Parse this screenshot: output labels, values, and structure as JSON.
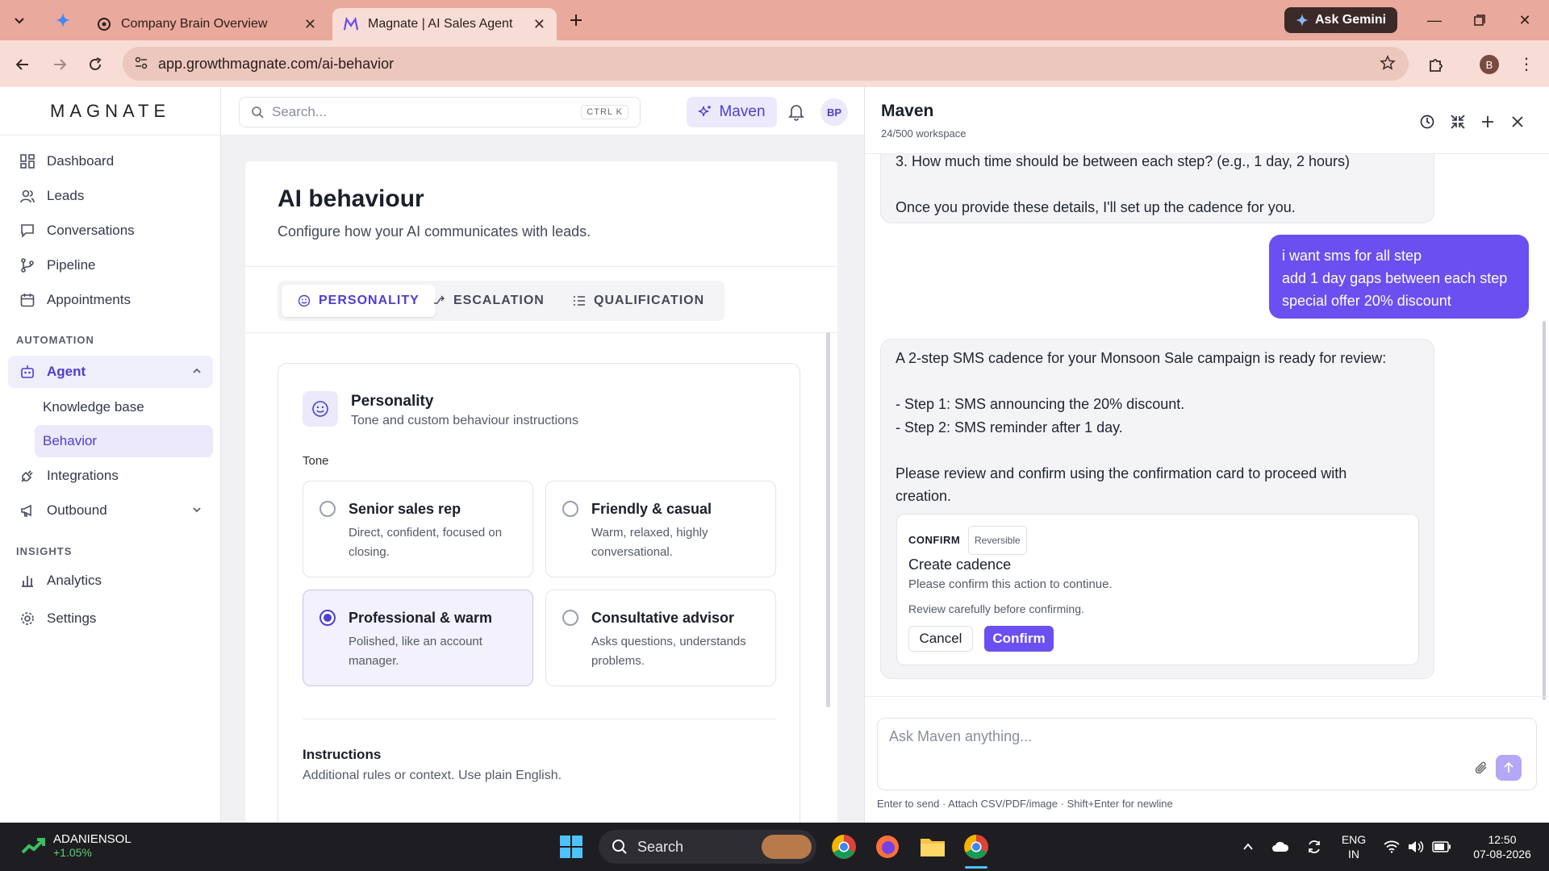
{
  "browser": {
    "tabs": [
      {
        "title": "Company Brain Overview",
        "active": false
      },
      {
        "title": "Magnate | AI Sales Agent",
        "active": true
      }
    ],
    "gemini_label": "Ask Gemini",
    "url": "app.growthmagnate.com/ai-behavior",
    "profile_initial": "B"
  },
  "sidebar": {
    "logo": "MAGNATE",
    "items": [
      "Dashboard",
      "Leads",
      "Conversations",
      "Pipeline",
      "Appointments"
    ],
    "automation_heading": "AUTOMATION",
    "agent_label": "Agent",
    "agent_sub": [
      "Knowledge base",
      "Behavior"
    ],
    "integrations": "Integrations",
    "outbound": "Outbound",
    "insights_heading": "INSIGHTS",
    "analytics": "Analytics",
    "settings": "Settings"
  },
  "topbar": {
    "search_placeholder": "Search...",
    "shortcut": "CTRL K",
    "maven_label": "Maven",
    "avatar_initials": "BP"
  },
  "page": {
    "title": "AI behaviour",
    "subtitle": "Configure how your AI communicates with leads.",
    "tabs": [
      "PERSONALITY",
      "ESCALATION",
      "QUALIFICATION"
    ],
    "personality": {
      "title": "Personality",
      "subtitle": "Tone and custom behaviour instructions",
      "tone_label": "Tone",
      "options": [
        {
          "title": "Senior sales rep",
          "desc": "Direct, confident, focused on closing.",
          "selected": false
        },
        {
          "title": "Friendly & casual",
          "desc": "Warm, relaxed, highly conversational.",
          "selected": false
        },
        {
          "title": "Professional & warm",
          "desc": "Polished, like an account manager.",
          "selected": true
        },
        {
          "title": "Consultative advisor",
          "desc": "Asks questions, understands problems.",
          "selected": false
        }
      ],
      "instructions_title": "Instructions",
      "instructions_sub": "Additional rules or context. Use plain English."
    }
  },
  "maven": {
    "title": "Maven",
    "usage": "24/500 workspace",
    "msg1_lines": [
      "3. How much time should be between each step? (e.g., 1 day, 2 hours)",
      "Once you provide these details, I'll set up the cadence for you."
    ],
    "user_msg": [
      "i want sms for all step",
      "add 1 day gaps between each step",
      "special offer 20% discount"
    ],
    "msg2_lines": [
      "A 2-step SMS cadence for your Monsoon Sale campaign is ready for review:",
      "- Step 1: SMS announcing the 20% discount.",
      "- Step 2: SMS reminder after 1 day.",
      "Please review and confirm using the confirmation card to proceed with creation."
    ],
    "confirm_card": {
      "tag": "CONFIRM",
      "badge": "Reversible",
      "title": "Create cadence",
      "subtitle": "Please confirm this action to continue.",
      "note": "Review carefully before confirming.",
      "cancel": "Cancel",
      "confirm": "Confirm"
    },
    "composer_placeholder": "Ask Maven anything...",
    "hint": "Enter to send · Attach CSV/PDF/image · Shift+Enter for newline"
  },
  "taskbar": {
    "stock_name": "ADANIENSOL",
    "stock_change": "+1.05%",
    "search_label": "Search",
    "lang": "ENG",
    "region": "IN",
    "time": "12:50",
    "date": "07-08-2026"
  },
  "colors": {
    "accent": "#6b4ff0",
    "tabbar": "#e9a99c",
    "addrbar": "#f8ddd6"
  }
}
